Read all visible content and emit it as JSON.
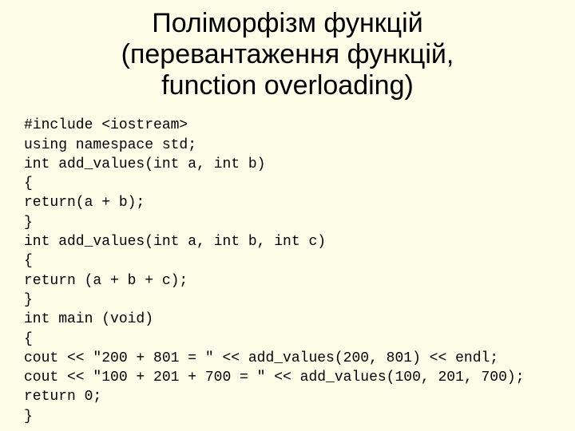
{
  "title_lines": [
    "Поліморфізм функцій",
    "(перевантаження функцій,",
    "function overloading)"
  ],
  "code_lines": [
    "#include <iostream>",
    "using namespace std;",
    "int add_values(int a, int b)",
    "{",
    "return(a + b);",
    "}",
    "int add_values(int a, int b, int с)",
    "{",
    "return (a + b + с);",
    "}",
    "int main (void)",
    "{",
    "cout << \"200 + 801 = \" << add_values(200, 801) << endl;",
    "cout << \"100 + 201 + 700 = \" << add_values(100, 201, 700);",
    "return 0;",
    "}"
  ]
}
